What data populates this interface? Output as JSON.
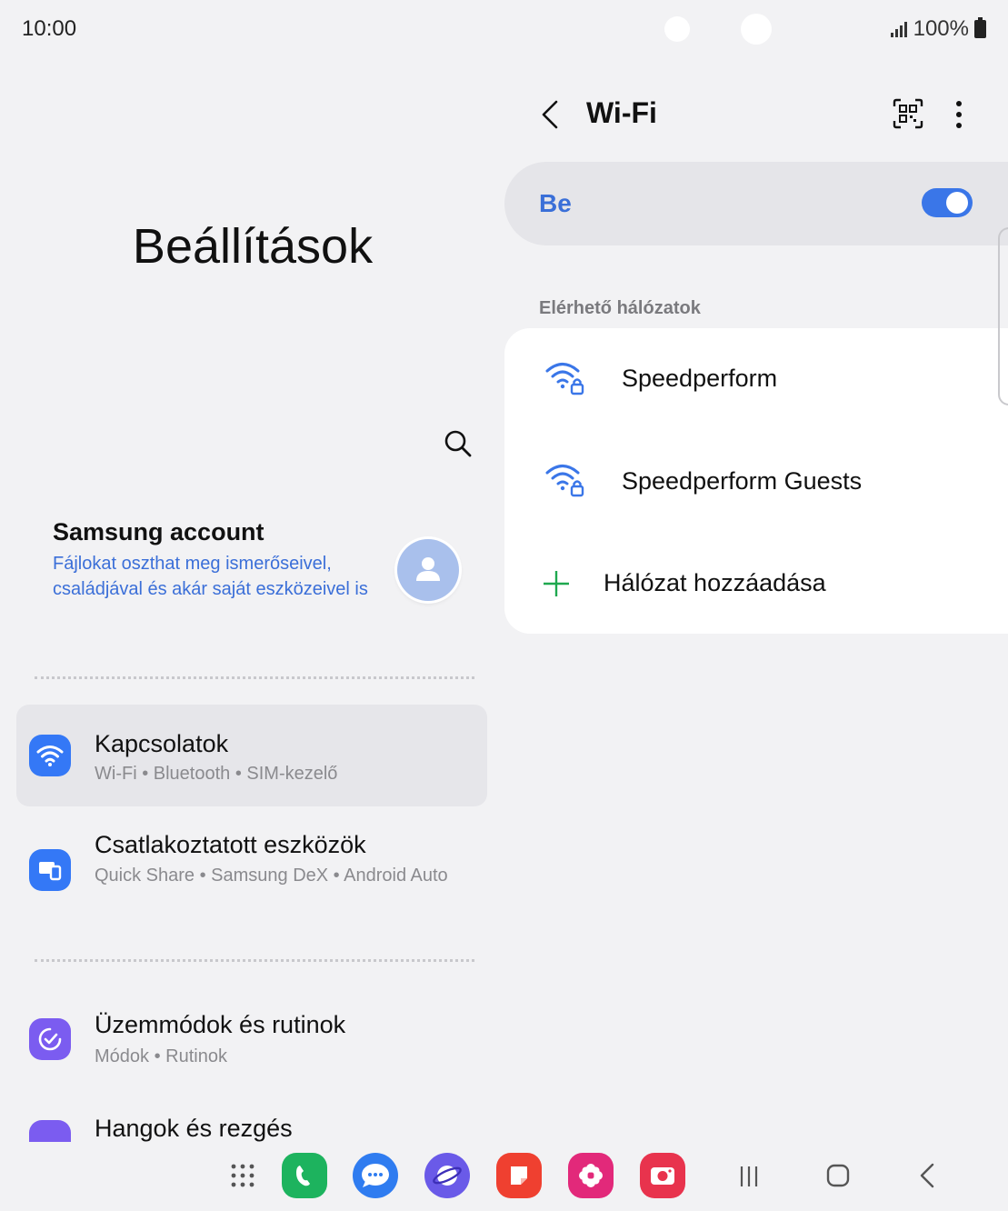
{
  "status_bar": {
    "time": "10:00",
    "battery": "100%"
  },
  "settings": {
    "title": "Beállítások",
    "account": {
      "title": "Samsung account",
      "description": "Fájlokat oszthat meg ismerőseivel, családjával és akár saját eszközeivel is"
    },
    "items": [
      {
        "title": "Kapcsolatok",
        "subtitle": "Wi-Fi  •  Bluetooth  •  SIM-kezelő",
        "selected": true,
        "icon": "wifi-icon",
        "color": "#3478f6"
      },
      {
        "title": "Csatlakoztatott eszközök",
        "subtitle": "Quick Share  •  Samsung DeX  •  Android Auto",
        "icon": "devices-icon",
        "color": "#3478f6"
      },
      {
        "title": "Üzemmódok és rutinok",
        "subtitle": "Módok  •  Rutinok",
        "icon": "modes-icon",
        "color": "#7b5cf0"
      },
      {
        "title": "Hangok és rezgés",
        "subtitle": "",
        "icon": "sound-icon",
        "color": "#7b5cf0"
      }
    ]
  },
  "wifi": {
    "title": "Wi-Fi",
    "toggle_label": "Be",
    "toggle_on": true,
    "section_label": "Elérhető hálózatok",
    "networks": [
      {
        "name": "Speedperform",
        "secured": true
      },
      {
        "name": "Speedperform Guests",
        "secured": true
      }
    ],
    "add_network_label": "Hálózat hozzáadása"
  },
  "dock": {
    "apps": [
      {
        "name": "apps-grid-icon"
      },
      {
        "name": "phone-icon",
        "color": "#1db35e"
      },
      {
        "name": "messages-icon",
        "color": "#2f7cf0"
      },
      {
        "name": "internet-icon",
        "color": "#6a5ae8"
      },
      {
        "name": "notes-icon",
        "color": "#ef4030"
      },
      {
        "name": "gallery-icon",
        "color": "#e2297a"
      },
      {
        "name": "camera-icon",
        "color": "#e8334d"
      }
    ]
  },
  "colors": {
    "accent": "#3a76e8",
    "link": "#3b6fd8",
    "background": "#f2f2f4"
  }
}
